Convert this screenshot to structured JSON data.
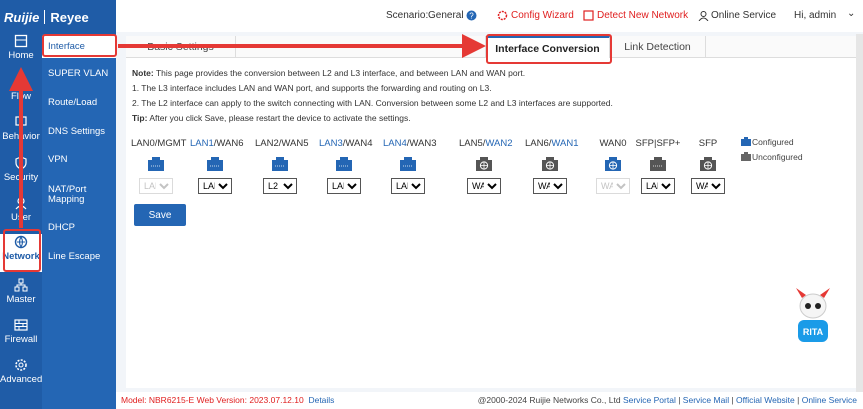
{
  "brand": {
    "left": "Ruijie",
    "right": "Reyee"
  },
  "topbar": {
    "scenario_label": "Scenario:",
    "scenario_value": "General",
    "config_wizard": "Config Wizard",
    "detect_network": "Detect New Network",
    "online_service": "Online Service",
    "greeting": "Hi, admin"
  },
  "rail": [
    {
      "label": "Home",
      "icon": "home-icon"
    },
    {
      "label": "Flow",
      "icon": "flow-icon"
    },
    {
      "label": "Behavior",
      "icon": "behavior-icon"
    },
    {
      "label": "Security",
      "icon": "security-icon"
    },
    {
      "label": "User",
      "icon": "user-icon"
    },
    {
      "label": "Network",
      "icon": "network-icon"
    },
    {
      "label": "Master",
      "icon": "master-icon"
    },
    {
      "label": "Firewall",
      "icon": "firewall-icon"
    },
    {
      "label": "Advanced",
      "icon": "advanced-icon"
    }
  ],
  "submenu": [
    "Interface",
    "SUPER VLAN",
    "Route/Load",
    "DNS Settings",
    "VPN",
    "NAT/Port",
    "Mapping",
    "DHCP",
    "Line Escape"
  ],
  "tabs": [
    "Basic Settings",
    "Interface Conversion",
    "Link Detection"
  ],
  "note": {
    "prefix": "Note:",
    "line0": "This page provides the conversion between L2 and L3 interface, and between LAN and WAN port.",
    "line1": "1. The L3 interface includes LAN and WAN port, and supports the forwarding and routing on L3.",
    "line2": "2. The L2 interface can apply to the switch connecting with LAN. Conversion between some L2 and L3 interfaces are supported.",
    "tip_prefix": "Tip:",
    "tip": "After you click Save, please restart the device to activate the settings."
  },
  "ports": [
    {
      "a": "LAN0/MGMT",
      "b": "",
      "value": "LAN",
      "type": "lan",
      "disabled": true
    },
    {
      "a": "LAN1",
      "b": "/WAN6",
      "value": "LAN",
      "type": "lan",
      "disabled": false
    },
    {
      "a": "LAN2/WAN5",
      "b": "",
      "value": "L2",
      "type": "lan",
      "disabled": false
    },
    {
      "a": "LAN3",
      "b": "/WAN4",
      "value": "LAN",
      "type": "lan",
      "disabled": false
    },
    {
      "a": "LAN4",
      "b": "/WAN3",
      "value": "LAN",
      "type": "lan",
      "disabled": false
    },
    {
      "a": "LAN5/",
      "b": "WAN2",
      "value": "WAN",
      "type": "wan",
      "disabled": false
    },
    {
      "a": "LAN6/",
      "b": "WAN1",
      "value": "WAN",
      "type": "wan",
      "disabled": false
    },
    {
      "a": "WAN0",
      "b": "",
      "value": "WAN",
      "type": "wan-blue",
      "disabled": true
    },
    {
      "a": "SFP|SFP+",
      "b": "",
      "value": "LAN",
      "type": "sfp",
      "disabled": false
    },
    {
      "a": "SFP",
      "b": "",
      "value": "WAN",
      "type": "sfp-wan",
      "disabled": false
    }
  ],
  "legend": {
    "configured": "Configured",
    "unconfigured": "Unconfigured"
  },
  "save_label": "Save",
  "footer": {
    "model": "Model:  NBR6215-E  Web Version:  2023.07.12.10",
    "details": "Details",
    "copyright": "@2000-2024 Ruijie Networks Co., Ltd",
    "links": [
      "Service Portal",
      "Service Mail",
      "Official Website",
      "Online Service"
    ]
  },
  "mascot": "RITA",
  "colors": {
    "primary": "#1f5ca7",
    "highlight": "#e53935"
  }
}
